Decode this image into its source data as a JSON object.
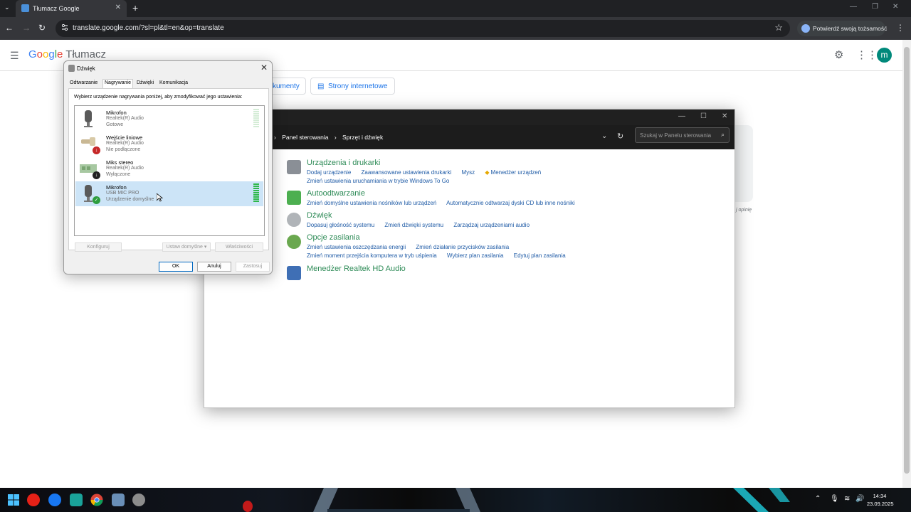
{
  "browser": {
    "tab_title": "Tłumacz Google",
    "url": "translate.google.com/?sl=pl&tl=en&op=translate",
    "identity_label": "Potwierdź swoją tożsamość"
  },
  "translate": {
    "logo_google": [
      "G",
      "o",
      "o",
      "g",
      "l",
      "e"
    ],
    "logo_app": "Tłumacz",
    "chip_documents": "kumenty",
    "chip_websites": "Strony internetowe",
    "avatar_letter": "m",
    "feedback_text": "j opinię"
  },
  "control_panel": {
    "breadcrumb": [
      "Panel sterowania",
      "Sprzęt i dźwięk"
    ],
    "search_placeholder": "Szukaj w Panelu sterowania",
    "categories": [
      {
        "title": "Urządzenia i drukarki",
        "links": [
          "Dodaj urządzenie",
          "Zaawansowane ustawienia drukarki",
          "Mysz",
          "Menedżer urządzeń"
        ],
        "links2": [
          "Zmień ustawienia uruchamiania w trybie Windows To Go"
        ]
      },
      {
        "title": "Autoodtwarzanie",
        "links": [
          "Zmień domyślne ustawienia nośników lub urządzeń",
          "Automatycznie odtwarzaj dyski CD lub inne nośniki"
        ],
        "links2": []
      },
      {
        "title": "Dźwięk",
        "links": [
          "Dopasuj głośność systemu",
          "Zmień dźwięki systemu",
          "Zarządzaj urządzeniami audio"
        ],
        "links2": []
      },
      {
        "title": "Opcje zasilania",
        "links": [
          "Zmień ustawienia oszczędzania energii",
          "Zmień działanie przycisków zasilania"
        ],
        "links2": [
          "Zmień moment przejścia komputera w tryb uśpienia",
          "Wybierz plan zasilania",
          "Edytuj plan zasilania"
        ]
      },
      {
        "title": "Menedżer Realtek HD Audio",
        "links": [],
        "links2": []
      }
    ]
  },
  "sound_dialog": {
    "title": "Dźwięk",
    "tabs": [
      "Odtwarzanie",
      "Nagrywanie",
      "Dźwięki",
      "Komunikacja"
    ],
    "active_tab": "Nagrywanie",
    "instruction": "Wybierz urządzenie nagrywania poniżej, aby zmodyfikować jego ustawienia:",
    "devices": [
      {
        "name": "Mikrofon",
        "driver": "Realtek(R) Audio",
        "status": "Gotowe",
        "selected": false,
        "level": 0
      },
      {
        "name": "Wejście liniowe",
        "driver": "Realtek(R) Audio",
        "status": "Nie podłączone",
        "selected": false
      },
      {
        "name": "Miks stereo",
        "driver": "Realtek(R) Audio",
        "status": "Wyłączone",
        "selected": false
      },
      {
        "name": "Mikrofon",
        "driver": "USB MIC PRO",
        "status": "Urządzenie domyślne",
        "selected": true,
        "level": 1
      }
    ],
    "buttons": {
      "configure": "Konfiguruj",
      "set_default": "Ustaw domyślne",
      "properties": "Właściwości",
      "ok": "OK",
      "cancel": "Anuluj",
      "apply": "Zastosuj"
    }
  },
  "taskbar": {
    "time": "14:34",
    "date": "23.09.2025"
  },
  "colors": {
    "accent_blue": "#1a73e8",
    "cp_heading": "#2e8b57",
    "cp_link": "#1f5ba6",
    "meter_green": "#2fb84a"
  }
}
